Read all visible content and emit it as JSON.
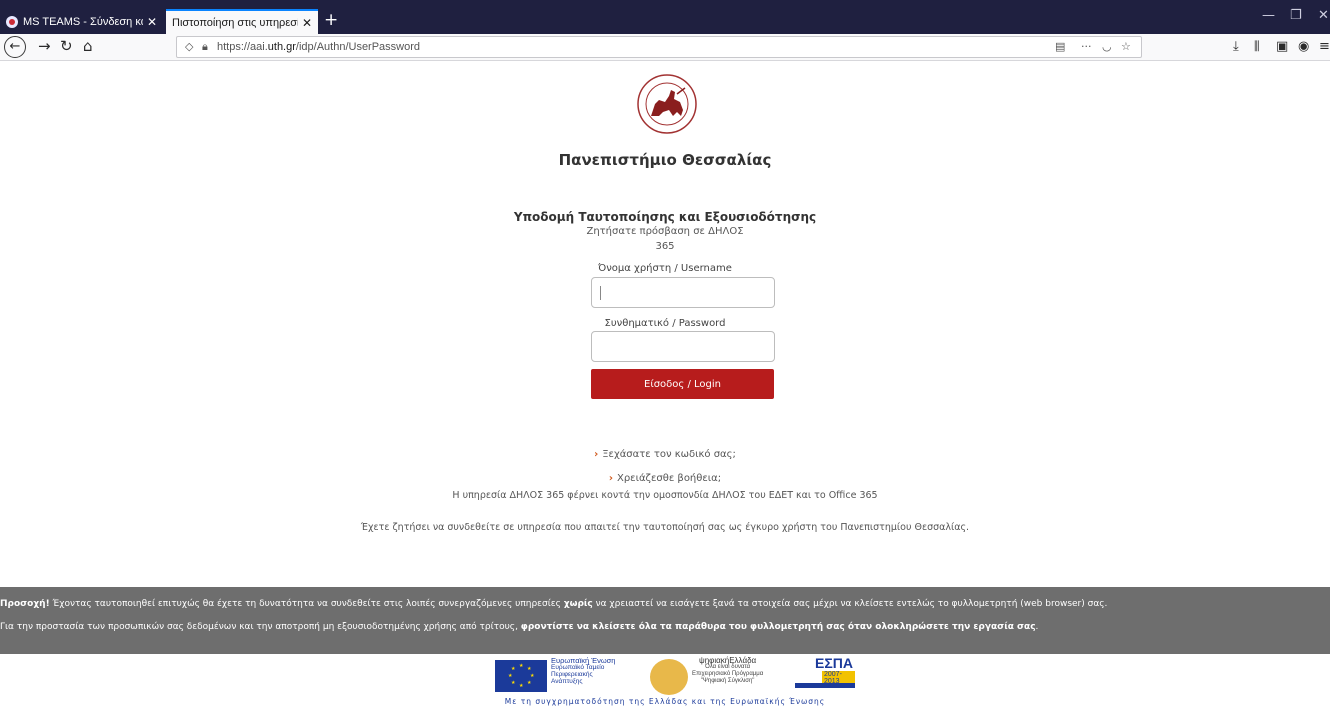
{
  "browser": {
    "tabs": [
      {
        "title": "MS TEAMS - Σύνδεση και Χρήση"
      },
      {
        "title": "Πιστοποίηση στις υπηρεσίες του Π"
      }
    ],
    "new_tab_symbol": "+",
    "url_prefix": "https://aai.",
    "url_domain": "uth.gr",
    "url_path": "/idp/Authn/UserPassword",
    "toolbar_icons": [
      "back-icon",
      "forward-icon",
      "reload-icon",
      "home-icon",
      "shield-icon",
      "lock-icon",
      "reader-icon",
      "more-icon",
      "pocket-icon",
      "star-icon",
      "download-icon",
      "library-icon",
      "sidebar-icon",
      "account-icon",
      "menu-icon"
    ]
  },
  "page": {
    "university": "Πανεπιστήμιο Θεσσαλίας",
    "heading": "Υποδομή Ταυτοποίησης και Εξουσιοδότησης",
    "requested_line1": "Ζητήσατε πρόσβαση σε ΔΗΛΟΣ",
    "requested_line2": "365",
    "username_label": "Όνομα χρήστη / Username",
    "username_value": "",
    "password_label": "Συνθηματικό / Password",
    "password_value": "",
    "login_label": "Είσοδος / Login",
    "forgot_link": "Ξεχάσατε τον κωδικό σας;",
    "help_link": "Χρειάζεσθε βοήθεια;",
    "delos_info": "Η υπηρεσία ΔΗΛΟΣ 365 φέρνει κοντά την ομοσπονδία ΔΗΛΟΣ του ΕΔΕΤ και το Office 365",
    "auth_info": "Έχετε ζητήσει να συνδεθείτε σε υπηρεσία που απαιτεί την ταυτοποίησή σας ως έγκυρο χρήστη του Πανεπιστημίου Θεσσαλίας."
  },
  "notice": {
    "line1_bold": "Προσοχή!",
    "line1_a": " Έχοντας ταυτοποιηθεί επιτυχώς θα έχετε τη δυνατότητα να συνδεθείτε στις λοιπές συνεργαζόμενες υπηρεσίες ",
    "line1_bold2": "χωρίς",
    "line1_b": " να χρειαστεί να εισάγετε ξανά τα στοιχεία σας μέχρι να κλείσετε εντελώς το φυλλομετρητή (web browser) σας.",
    "line2_a": "Για την προστασία των προσωπικών σας δεδομένων και την αποτροπή μη εξουσιοδοτημένης χρήσης από τρίτους, ",
    "line2_bold": "φροντίστε να κλείσετε όλα τα παράθυρα του φυλλομετρητή σας όταν ολοκληρώσετε την εργασία σας",
    "line2_end": "."
  },
  "footer": {
    "eu_line1": "Ευρωπαϊκή Ένωση",
    "eu_line2": "Ευρωπαϊκό Ταμείο",
    "eu_line3": "Περιφερειακής",
    "eu_line4": "Ανάπτυξης",
    "digital_line1": "ψηφιακήΕλλάδα",
    "digital_line2": "Όλα είναι δυνατά",
    "digital_line3": "Επιχειρησιακό Πρόγραμμα",
    "digital_line4": "\"Ψηφιακή Σύγκλιση\"",
    "espa_title": "ΕΣΠΑ",
    "espa_years": "2007-2013",
    "cofunding": "Με τη συγχρηματοδότηση της Ελλάδας και της Ευρωπαϊκής Ένωσης"
  },
  "colors": {
    "accent_red": "#b71c1c",
    "link_arrow": "#d05a1e",
    "notice_bg": "#6e6e6e",
    "tabbar_bg": "#1f2040"
  }
}
